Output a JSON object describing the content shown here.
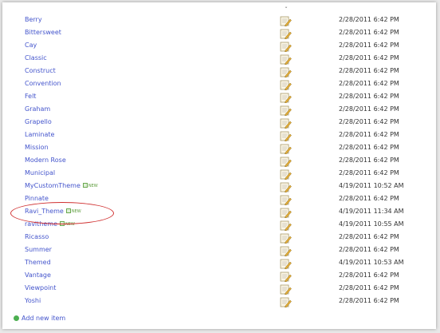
{
  "sort_indicator": "ˇ",
  "themes": [
    {
      "name": "Berry",
      "modified": "2/28/2011 6:42 PM"
    },
    {
      "name": "Bittersweet",
      "modified": "2/28/2011 6:42 PM"
    },
    {
      "name": "Cay",
      "modified": "2/28/2011 6:42 PM"
    },
    {
      "name": "Classic",
      "modified": "2/28/2011 6:42 PM"
    },
    {
      "name": "Construct",
      "modified": "2/28/2011 6:42 PM"
    },
    {
      "name": "Convention",
      "modified": "2/28/2011 6:42 PM"
    },
    {
      "name": "Felt",
      "modified": "2/28/2011 6:42 PM"
    },
    {
      "name": "Graham",
      "modified": "2/28/2011 6:42 PM"
    },
    {
      "name": "Grapello",
      "modified": "2/28/2011 6:42 PM"
    },
    {
      "name": "Laminate",
      "modified": "2/28/2011 6:42 PM"
    },
    {
      "name": "Mission",
      "modified": "2/28/2011 6:42 PM"
    },
    {
      "name": "Modern Rose",
      "modified": "2/28/2011 6:42 PM"
    },
    {
      "name": "Municipal",
      "modified": "2/28/2011 6:42 PM"
    },
    {
      "name": "MyCustomTheme",
      "new_label": "NEW",
      "modified": "4/19/2011 10:52 AM"
    },
    {
      "name": "Pinnate",
      "modified": "2/28/2011 6:42 PM"
    },
    {
      "name": "Ravi_Theme",
      "new_label": "NEW",
      "modified": "4/19/2011 11:34 AM",
      "circled": true
    },
    {
      "name": "ravitheme",
      "new_label": "NEW",
      "modified": "4/19/2011 10:55 AM"
    },
    {
      "name": "Ricasso",
      "modified": "2/28/2011 6:42 PM"
    },
    {
      "name": "Summer",
      "modified": "2/28/2011 6:42 PM"
    },
    {
      "name": "Themed",
      "modified": "4/19/2011 10:53 AM"
    },
    {
      "name": "Vantage",
      "modified": "2/28/2011 6:42 PM"
    },
    {
      "name": "Viewpoint",
      "modified": "2/28/2011 6:42 PM"
    },
    {
      "name": "Yoshi",
      "modified": "2/28/2011 6:42 PM"
    }
  ],
  "add_new_item": "Add new item",
  "colors": {
    "link": "#4455cc",
    "new_badge": "#5b9b3a",
    "highlight": "#d03030",
    "add_icon": "#4caf50"
  },
  "icons": {
    "row_icon": "edit-document-icon",
    "add_icon": "add-item-icon"
  }
}
